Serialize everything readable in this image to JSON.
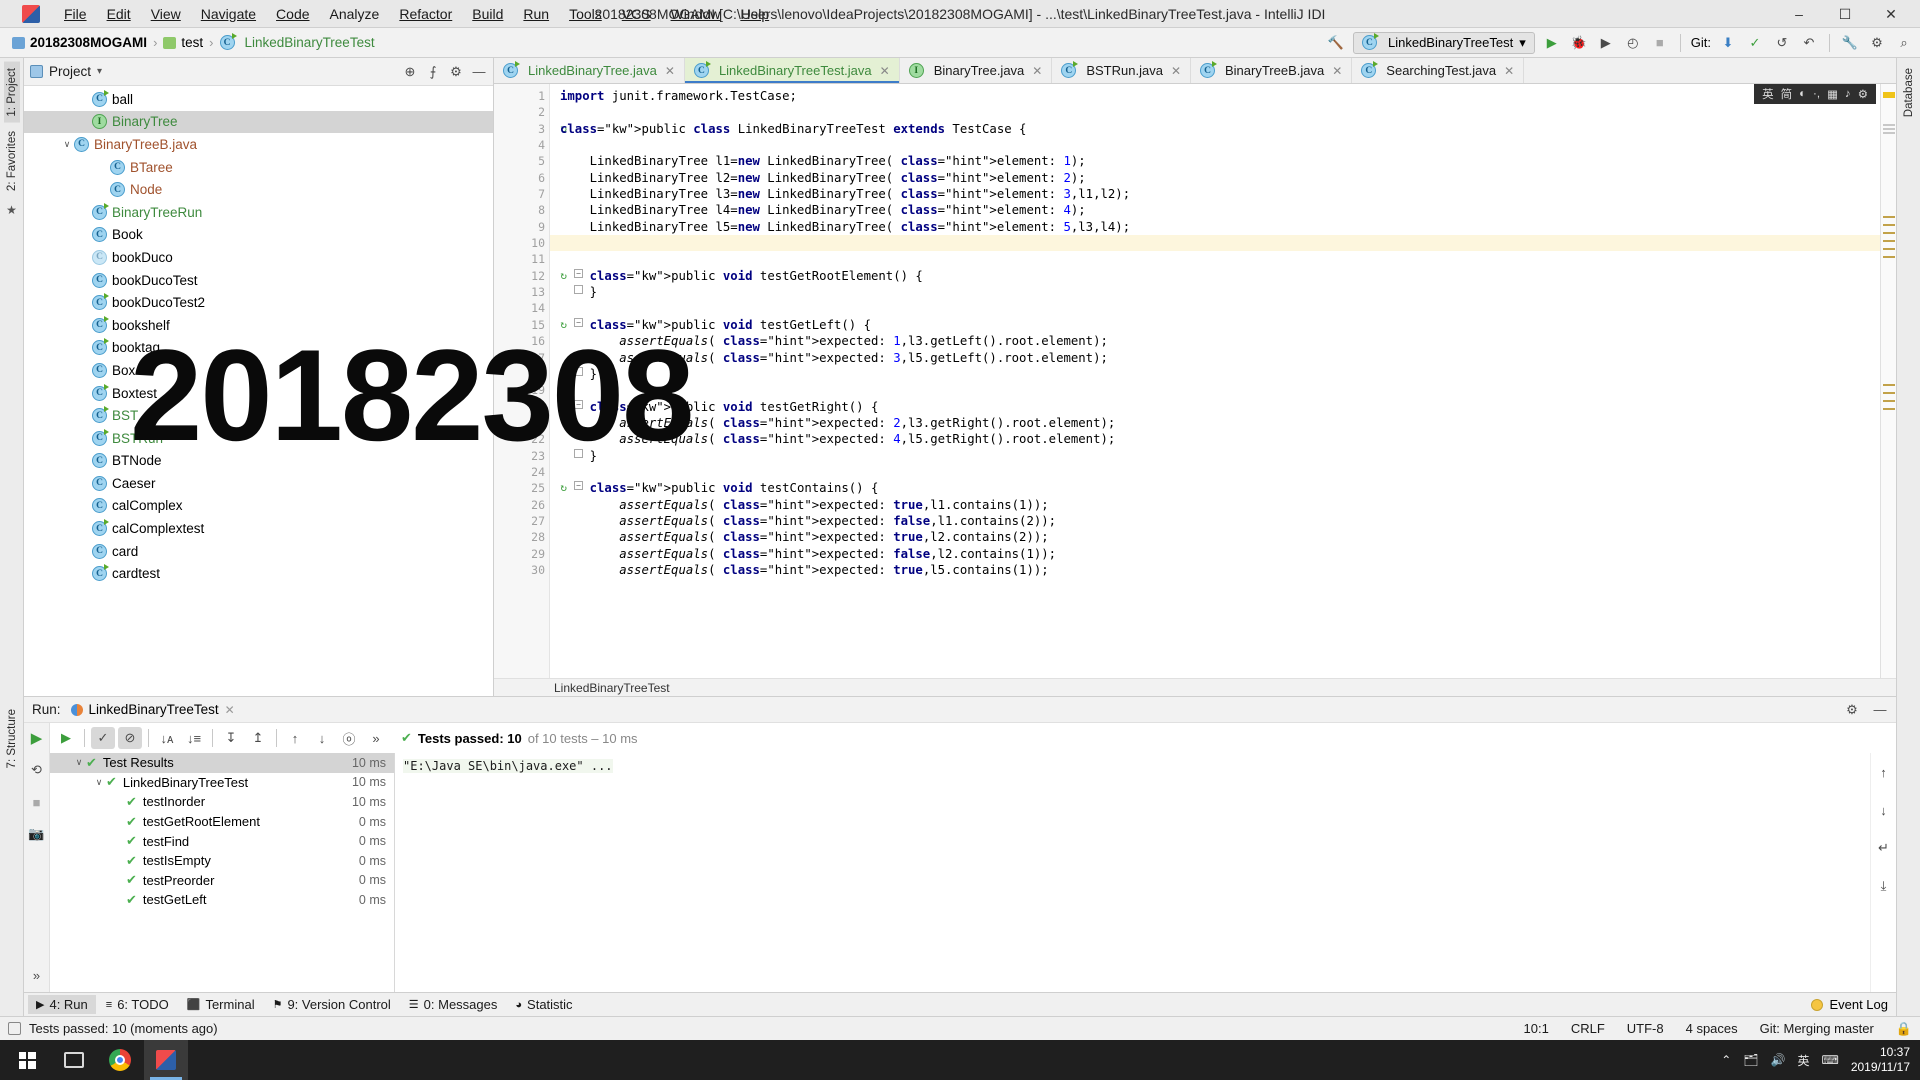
{
  "window": {
    "title": "20182308MOGAMI [C:\\Users\\lenovo\\IdeaProjects\\20182308MOGAMI] - ...\\test\\LinkedBinaryTreeTest.java - IntelliJ IDI",
    "minimize": "–",
    "maximize": "☐",
    "close": "✕"
  },
  "menubar": [
    {
      "label": "File"
    },
    {
      "label": "Edit"
    },
    {
      "label": "View"
    },
    {
      "label": "Navigate"
    },
    {
      "label": "Code"
    },
    {
      "label": "Analyze"
    },
    {
      "label": "Refactor"
    },
    {
      "label": "Build"
    },
    {
      "label": "Run"
    },
    {
      "label": "Tools"
    },
    {
      "label": "VCS"
    },
    {
      "label": "Window"
    },
    {
      "label": "Help"
    }
  ],
  "breadcrumb": {
    "project": "20182308MOGAMI",
    "folder": "test",
    "file": "LinkedBinaryTreeTest",
    "separator": "›"
  },
  "toolbar": {
    "run_config": "LinkedBinaryTreeTest",
    "run_config_chevron": "▾",
    "run_icon": "▶",
    "debug_icon": "🐞",
    "run_coverage_icon": "▶",
    "profile_icon": "◴",
    "stop_icon": "■",
    "git_label": "Git:",
    "update_icon": "⬇",
    "commit_icon": "✓",
    "history_icon": "↺",
    "rollback_icon": "↶",
    "search_icon": "⌕",
    "settings_icon": "⚙",
    "hammer_icon": "🔨",
    "wrench_icon": "🔧"
  },
  "left_strip": [
    {
      "label": "1: Project",
      "active": true
    },
    {
      "label": "2: Favorites",
      "active": false
    },
    {
      "label": "7: Structure",
      "active": false
    }
  ],
  "right_strip": [
    {
      "label": "Database",
      "active": false
    }
  ],
  "project_pane": {
    "title": "Project",
    "chevron": "▾",
    "locate_icon": "⊕",
    "collapse_icon": "⨍",
    "settings_icon": "⚙",
    "hide_icon": "—",
    "tree": [
      {
        "indent": 2,
        "arrow": "",
        "icon": "class-run",
        "label": "ball",
        "color": "normal",
        "selected": false
      },
      {
        "indent": 2,
        "arrow": "",
        "icon": "interface",
        "label": "BinaryTree",
        "color": "green",
        "selected": true
      },
      {
        "indent": 1,
        "arrow": "∨",
        "icon": "class",
        "label": "BinaryTreeB.java",
        "color": "brown",
        "selected": false
      },
      {
        "indent": 3,
        "arrow": "",
        "icon": "class",
        "label": "BTaree",
        "color": "brown",
        "selected": false
      },
      {
        "indent": 3,
        "arrow": "",
        "icon": "class",
        "label": "Node",
        "color": "brown",
        "selected": false
      },
      {
        "indent": 2,
        "arrow": "",
        "icon": "class-run",
        "label": "BinaryTreeRun",
        "color": "green",
        "selected": false
      },
      {
        "indent": 2,
        "arrow": "",
        "icon": "class",
        "label": "Book",
        "color": "normal",
        "selected": false
      },
      {
        "indent": 2,
        "arrow": "",
        "icon": "class-faded",
        "label": "bookDuco",
        "color": "normal",
        "selected": false
      },
      {
        "indent": 2,
        "arrow": "",
        "icon": "class",
        "label": "bookDucoTest",
        "color": "normal",
        "selected": false
      },
      {
        "indent": 2,
        "arrow": "",
        "icon": "class-run",
        "label": "bookDucoTest2",
        "color": "normal",
        "selected": false
      },
      {
        "indent": 2,
        "arrow": "",
        "icon": "class-run",
        "label": "bookshelf",
        "color": "normal",
        "selected": false
      },
      {
        "indent": 2,
        "arrow": "",
        "icon": "class-run",
        "label": "booktag",
        "color": "normal",
        "selected": false
      },
      {
        "indent": 2,
        "arrow": "",
        "icon": "class",
        "label": "Box",
        "color": "normal",
        "selected": false
      },
      {
        "indent": 2,
        "arrow": "",
        "icon": "class-run",
        "label": "Boxtest",
        "color": "normal",
        "selected": false
      },
      {
        "indent": 2,
        "arrow": "",
        "icon": "class-run",
        "label": "BST",
        "color": "green",
        "selected": false
      },
      {
        "indent": 2,
        "arrow": "",
        "icon": "class-run",
        "label": "BSTRun",
        "color": "green",
        "selected": false
      },
      {
        "indent": 2,
        "arrow": "",
        "icon": "class",
        "label": "BTNode",
        "color": "normal",
        "selected": false
      },
      {
        "indent": 2,
        "arrow": "",
        "icon": "class",
        "label": "Caeser",
        "color": "normal",
        "selected": false
      },
      {
        "indent": 2,
        "arrow": "",
        "icon": "class",
        "label": "calComplex",
        "color": "normal",
        "selected": false
      },
      {
        "indent": 2,
        "arrow": "",
        "icon": "class-run",
        "label": "calComplextest",
        "color": "normal",
        "selected": false
      },
      {
        "indent": 2,
        "arrow": "",
        "icon": "class",
        "label": "card",
        "color": "normal",
        "selected": false
      },
      {
        "indent": 2,
        "arrow": "",
        "icon": "class-run",
        "label": "cardtest",
        "color": "normal",
        "selected": false
      }
    ]
  },
  "editor": {
    "tabs": [
      {
        "label": "LinkedBinaryTree.java",
        "active": false,
        "color": "green",
        "close": "✕"
      },
      {
        "label": "LinkedBinaryTreeTest.java",
        "active": true,
        "color": "green",
        "close": "✕"
      },
      {
        "label": "BinaryTree.java",
        "active": false,
        "color": "normal",
        "close": "✕",
        "icon": "interface"
      },
      {
        "label": "BSTRun.java",
        "active": false,
        "color": "normal",
        "close": "✕"
      },
      {
        "label": "BinaryTreeB.java",
        "active": false,
        "color": "normal",
        "close": "✕"
      },
      {
        "label": "SearchingTest.java",
        "active": false,
        "color": "normal",
        "close": "✕"
      }
    ],
    "ime_bar": [
      "英",
      "简",
      "◐",
      "·,",
      "▦",
      "♪",
      "⚙"
    ],
    "breadcrumb_bottom": "LinkedBinaryTreeTest",
    "first_line": 1,
    "current_line": 10,
    "lines": [
      {
        "n": 1,
        "gutter_mark": "",
        "fold": "",
        "text": "import junit.framework.TestCase;"
      },
      {
        "n": 2,
        "gutter_mark": "",
        "fold": "",
        "text": ""
      },
      {
        "n": 3,
        "gutter_mark": "run",
        "fold": "",
        "text": "public class LinkedBinaryTreeTest extends TestCase {"
      },
      {
        "n": 4,
        "gutter_mark": "",
        "fold": "",
        "text": ""
      },
      {
        "n": 5,
        "gutter_mark": "",
        "fold": "",
        "text": "    LinkedBinaryTree l1=new LinkedBinaryTree( element: 1);"
      },
      {
        "n": 6,
        "gutter_mark": "",
        "fold": "",
        "text": "    LinkedBinaryTree l2=new LinkedBinaryTree( element: 2);"
      },
      {
        "n": 7,
        "gutter_mark": "",
        "fold": "",
        "text": "    LinkedBinaryTree l3=new LinkedBinaryTree( element: 3,l1,l2);"
      },
      {
        "n": 8,
        "gutter_mark": "",
        "fold": "",
        "text": "    LinkedBinaryTree l4=new LinkedBinaryTree( element: 4);"
      },
      {
        "n": 9,
        "gutter_mark": "",
        "fold": "",
        "text": "    LinkedBinaryTree l5=new LinkedBinaryTree( element: 5,l3,l4);"
      },
      {
        "n": 10,
        "gutter_mark": "",
        "fold": "",
        "text": ""
      },
      {
        "n": 11,
        "gutter_mark": "",
        "fold": "",
        "text": ""
      },
      {
        "n": 12,
        "gutter_mark": "run",
        "fold": "minus",
        "text": "    public void testGetRootElement() {"
      },
      {
        "n": 13,
        "gutter_mark": "",
        "fold": "end",
        "text": "    }"
      },
      {
        "n": 14,
        "gutter_mark": "",
        "fold": "",
        "text": ""
      },
      {
        "n": 15,
        "gutter_mark": "run",
        "fold": "minus",
        "text": "    public void testGetLeft() {"
      },
      {
        "n": 16,
        "gutter_mark": "",
        "fold": "",
        "text": "        assertEquals( expected: 1,l3.getLeft().root.element);"
      },
      {
        "n": 17,
        "gutter_mark": "",
        "fold": "",
        "text": "        assertEquals( expected: 3,l5.getLeft().root.element);"
      },
      {
        "n": 18,
        "gutter_mark": "",
        "fold": "end",
        "text": "    }"
      },
      {
        "n": 19,
        "gutter_mark": "",
        "fold": "",
        "text": ""
      },
      {
        "n": 20,
        "gutter_mark": "run",
        "fold": "minus",
        "text": "    public void testGetRight() {"
      },
      {
        "n": 21,
        "gutter_mark": "",
        "fold": "",
        "text": "        assertEquals( expected: 2,l3.getRight().root.element);"
      },
      {
        "n": 22,
        "gutter_mark": "",
        "fold": "",
        "text": "        assertEquals( expected: 4,l5.getRight().root.element);"
      },
      {
        "n": 23,
        "gutter_mark": "",
        "fold": "end",
        "text": "    }"
      },
      {
        "n": 24,
        "gutter_mark": "",
        "fold": "",
        "text": ""
      },
      {
        "n": 25,
        "gutter_mark": "run",
        "fold": "minus",
        "text": "    public void testContains() {"
      },
      {
        "n": 26,
        "gutter_mark": "",
        "fold": "",
        "text": "        assertEquals( expected: true,l1.contains(1));"
      },
      {
        "n": 27,
        "gutter_mark": "",
        "fold": "",
        "text": "        assertEquals( expected: false,l1.contains(2));"
      },
      {
        "n": 28,
        "gutter_mark": "",
        "fold": "",
        "text": "        assertEquals( expected: true,l2.contains(2));"
      },
      {
        "n": 29,
        "gutter_mark": "",
        "fold": "",
        "text": "        assertEquals( expected: false,l2.contains(1));"
      },
      {
        "n": 30,
        "gutter_mark": "",
        "fold": "",
        "text": "        assertEquals( expected: true,l5.contains(1));"
      }
    ]
  },
  "watermark": "20182308",
  "run_panel": {
    "run_label": "Run:",
    "config_name": "LinkedBinaryTreeTest",
    "close_icon": "✕",
    "settings_icon": "⚙",
    "hide_icon": "—",
    "toolbar": [
      {
        "name": "rerun",
        "glyph": "▶",
        "active": false
      },
      {
        "name": "show-passed",
        "glyph": "✓",
        "active": true
      },
      {
        "name": "show-ignored",
        "glyph": "⊘",
        "active": true
      },
      {
        "name": "sort-alpha",
        "glyph": "↓ᴀ",
        "active": false
      },
      {
        "name": "sort-duration",
        "glyph": "↓≡",
        "active": false
      },
      {
        "name": "expand-all",
        "glyph": "↧",
        "active": false
      },
      {
        "name": "collapse-all",
        "glyph": "↥",
        "active": false
      },
      {
        "name": "prev-test",
        "glyph": "↑",
        "active": false
      },
      {
        "name": "next-test",
        "glyph": "↓",
        "active": false
      },
      {
        "name": "test-history",
        "glyph": "ⓞ",
        "active": false
      },
      {
        "name": "more",
        "glyph": "»",
        "active": false
      }
    ],
    "status_check": "✔",
    "status_bold": "Tests passed: 10",
    "status_rest": "of 10 tests – 10 ms",
    "left_tools": [
      "▶",
      "⟲",
      "■",
      "📷",
      "»"
    ],
    "tests": [
      {
        "indent": 0,
        "arrow": "∨",
        "label": "Test Results",
        "ms": "10 ms",
        "selected": true
      },
      {
        "indent": 1,
        "arrow": "∨",
        "label": "LinkedBinaryTreeTest",
        "ms": "10 ms",
        "selected": false
      },
      {
        "indent": 2,
        "arrow": "",
        "label": "testInorder",
        "ms": "10 ms",
        "selected": false
      },
      {
        "indent": 2,
        "arrow": "",
        "label": "testGetRootElement",
        "ms": "0 ms",
        "selected": false
      },
      {
        "indent": 2,
        "arrow": "",
        "label": "testFind",
        "ms": "0 ms",
        "selected": false
      },
      {
        "indent": 2,
        "arrow": "",
        "label": "testIsEmpty",
        "ms": "0 ms",
        "selected": false
      },
      {
        "indent": 2,
        "arrow": "",
        "label": "testPreorder",
        "ms": "0 ms",
        "selected": false
      },
      {
        "indent": 2,
        "arrow": "",
        "label": "testGetLeft",
        "ms": "0 ms",
        "selected": false
      }
    ],
    "console_text": "\"E:\\Java SE\\bin\\java.exe\" ...",
    "console_tools": [
      "↑",
      "↓",
      "↵",
      "⤓"
    ]
  },
  "bottom_bar": {
    "items": [
      {
        "glyph": "▶",
        "label": "4: Run",
        "active": true
      },
      {
        "glyph": "≡",
        "label": "6: TODO",
        "active": false
      },
      {
        "glyph": "⬛",
        "label": "Terminal",
        "active": false
      },
      {
        "glyph": "⚑",
        "label": "9: Version Control",
        "active": false
      },
      {
        "glyph": "☰",
        "label": "0: Messages",
        "active": false
      },
      {
        "glyph": "◕",
        "label": "Statistic",
        "active": false
      }
    ],
    "event_log": "Event Log"
  },
  "statusbar": {
    "message": "Tests passed: 10 (moments ago)",
    "caret": "10:1",
    "line_sep": "CRLF",
    "encoding": "UTF-8",
    "indent": "4 spaces",
    "git_branch": "Git: Merging master",
    "lock_icon": "🔒"
  },
  "taskbar": {
    "apps": [
      {
        "name": "task-view",
        "active": false
      },
      {
        "name": "chrome",
        "active": false
      },
      {
        "name": "intellij",
        "active": true
      }
    ],
    "tray": [
      "⌃",
      "🗂",
      "🔊",
      "英",
      "⌨"
    ],
    "time": "10:37",
    "date": "2019/11/17"
  }
}
